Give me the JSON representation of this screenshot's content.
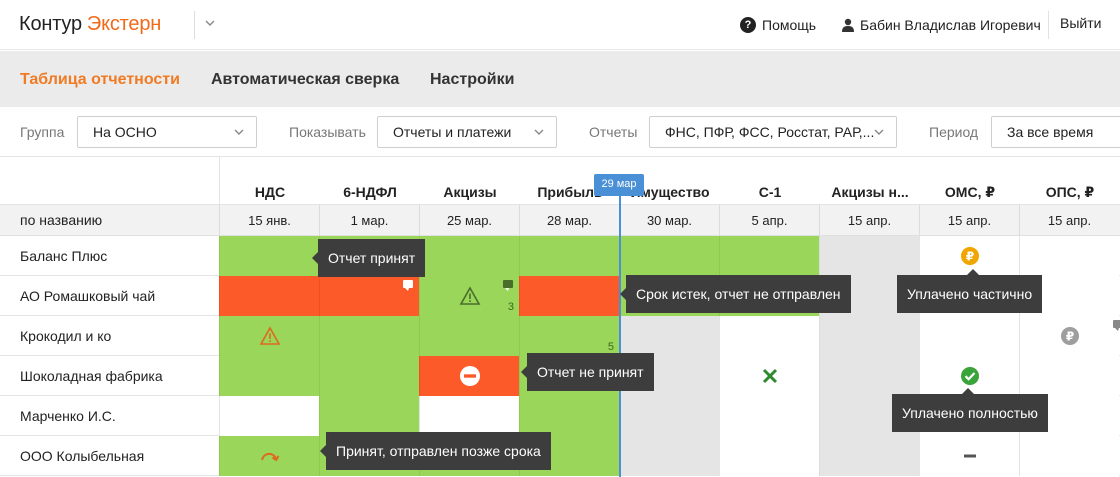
{
  "app": {
    "brand": "Контур",
    "product": "Экстерн"
  },
  "header": {
    "help_label": "Помощь",
    "user_name": "Бабин Владислав Игоревич",
    "logout_label": "Выйти"
  },
  "nav": {
    "tabs": [
      {
        "label": "Таблица отчетности",
        "active": true
      },
      {
        "label": "Автоматическая сверка",
        "active": false
      },
      {
        "label": "Настройки",
        "active": false
      }
    ]
  },
  "filters": {
    "group": {
      "label": "Группа",
      "value": "На ОСНО"
    },
    "show": {
      "label": "Показывать",
      "value": "Отчеты и платежи"
    },
    "reports": {
      "label": "Отчеты",
      "value": "ФНС, ПФР, ФСС, Росстат, РАР,..."
    },
    "period": {
      "label": "Период",
      "value": "За все время"
    }
  },
  "table": {
    "sort_label": "по названию",
    "today_label": "29 мар",
    "columns": [
      {
        "name": "НДС",
        "date": "15 янв."
      },
      {
        "name": "6-НДФЛ",
        "date": "1 мар."
      },
      {
        "name": "Акцизы",
        "date": "25 мар."
      },
      {
        "name": "Прибыль",
        "date": "28 мар."
      },
      {
        "name": "Имущество",
        "date": "30 мар."
      },
      {
        "name": "С-1",
        "date": "5 апр."
      },
      {
        "name": "Акцизы н...",
        "date": "15 апр."
      },
      {
        "name": "ОМС, ₽",
        "date": "15 апр."
      },
      {
        "name": "ОПС, ₽",
        "date": "15 апр."
      }
    ],
    "rows": [
      {
        "name": "Баланс Плюс"
      },
      {
        "name": "АО Ромашковый чай"
      },
      {
        "name": "Крокодил и ко"
      },
      {
        "name": "Шоколадная фабрика"
      },
      {
        "name": "Марченко И.С."
      },
      {
        "name": "ООО Колыбельная"
      }
    ],
    "counts": {
      "akcizy_romashka": "3",
      "pribyl_krokodil": "5"
    },
    "cell_icons": {
      "romashka_akcizy": "warning-triangle-icon",
      "krokodil_nds": "warning-triangle-icon",
      "shokolad_akcizy": "no-entry-icon",
      "shokolad_s1": "cross-icon",
      "balans_oms": "ruble-coin-icon",
      "shokolad_oms": "check-circle-icon",
      "krokodil_ops": "ruble-coin-icon",
      "kolybel_nds": "late-arrow-icon",
      "kolybel_oms": "dash-icon"
    }
  },
  "tooltips": {
    "accepted": "Отчет принят",
    "deadline_missed": "Срок истек, отчет не отправлен",
    "paid_partially": "Уплачено частично",
    "not_accepted": "Отчет не принят",
    "paid_fully": "Уплачено полностью",
    "accepted_late": "Принят, отправлен позже срока"
  },
  "colors": {
    "accent": "#f07b22",
    "green": "#99d65a",
    "red": "#fd5a2a",
    "gray": "#e5e5e5",
    "today": "#4a90d6",
    "tooltip": "#3d3d3d"
  }
}
